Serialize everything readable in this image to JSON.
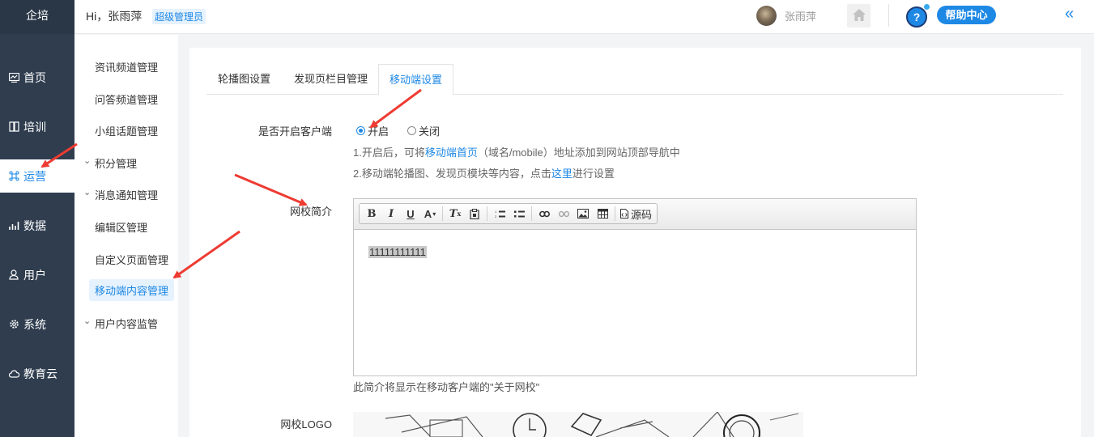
{
  "app": {
    "brand": "企培"
  },
  "header": {
    "greeting": "Hi，张雨萍",
    "role": "超级管理员",
    "user_name": "张雨萍",
    "help_label": "帮助中心",
    "help_icon_text": "?",
    "collapse_icon": "«"
  },
  "left_nav": {
    "items": [
      {
        "label": "首页",
        "icon": "dashboard-icon"
      },
      {
        "label": "培训",
        "icon": "training-icon"
      },
      {
        "label": "运营",
        "icon": "operation-icon",
        "active": true
      },
      {
        "label": "数据",
        "icon": "chart-icon"
      },
      {
        "label": "用户",
        "icon": "user-icon"
      },
      {
        "label": "系统",
        "icon": "gear-icon"
      },
      {
        "label": "教育云",
        "icon": "cloud-icon"
      }
    ]
  },
  "sub_nav": {
    "items": [
      {
        "label": "资讯频道管理"
      },
      {
        "label": "问答频道管理"
      },
      {
        "label": "小组话题管理"
      },
      {
        "label": "积分管理",
        "expandable": true
      },
      {
        "label": "消息通知管理",
        "expandable": true
      },
      {
        "label": "编辑区管理"
      },
      {
        "label": "自定义页面管理"
      },
      {
        "label": "移动端内容管理",
        "active": true
      },
      {
        "label": "用户内容监管",
        "expandable": true
      }
    ],
    "expand_glyph": "⌄"
  },
  "main": {
    "tabs": [
      {
        "label": "轮播图设置"
      },
      {
        "label": "发现页栏目管理"
      },
      {
        "label": "移动端设置",
        "active": true
      }
    ],
    "form": {
      "client_label": "是否开启客户端",
      "radio_on": "开启",
      "radio_off": "关闭",
      "client_enabled": true,
      "hint1_prefix": "1.开启后，可将",
      "hint1_link": "移动端首页",
      "hint1_suffix": "（域名/mobile）地址添加到网站顶部导航中",
      "hint2_prefix": "2.移动端轮播图、发现页模块等内容，点击",
      "hint2_link": "这里",
      "hint2_suffix": "进行设置",
      "intro_label": "网校简介",
      "editor_content": "11111111111",
      "editor_hint": "此简介将显示在移动客户端的\"关于网校\"",
      "logo_label": "网校LOGO"
    },
    "editor_toolbar": {
      "source_label": "源码",
      "buttons": [
        "bold-icon",
        "italic-icon",
        "underline-icon",
        "font-color-icon",
        "clear-format-icon",
        "paste-icon",
        "ordered-list-icon",
        "unordered-list-icon",
        "link-icon",
        "unlink-icon",
        "image-icon",
        "table-icon",
        "source-icon"
      ]
    }
  },
  "colors": {
    "accent": "#1e88e5",
    "nav_bg": "#2f3d4f",
    "arrow": "#ee3b32"
  }
}
